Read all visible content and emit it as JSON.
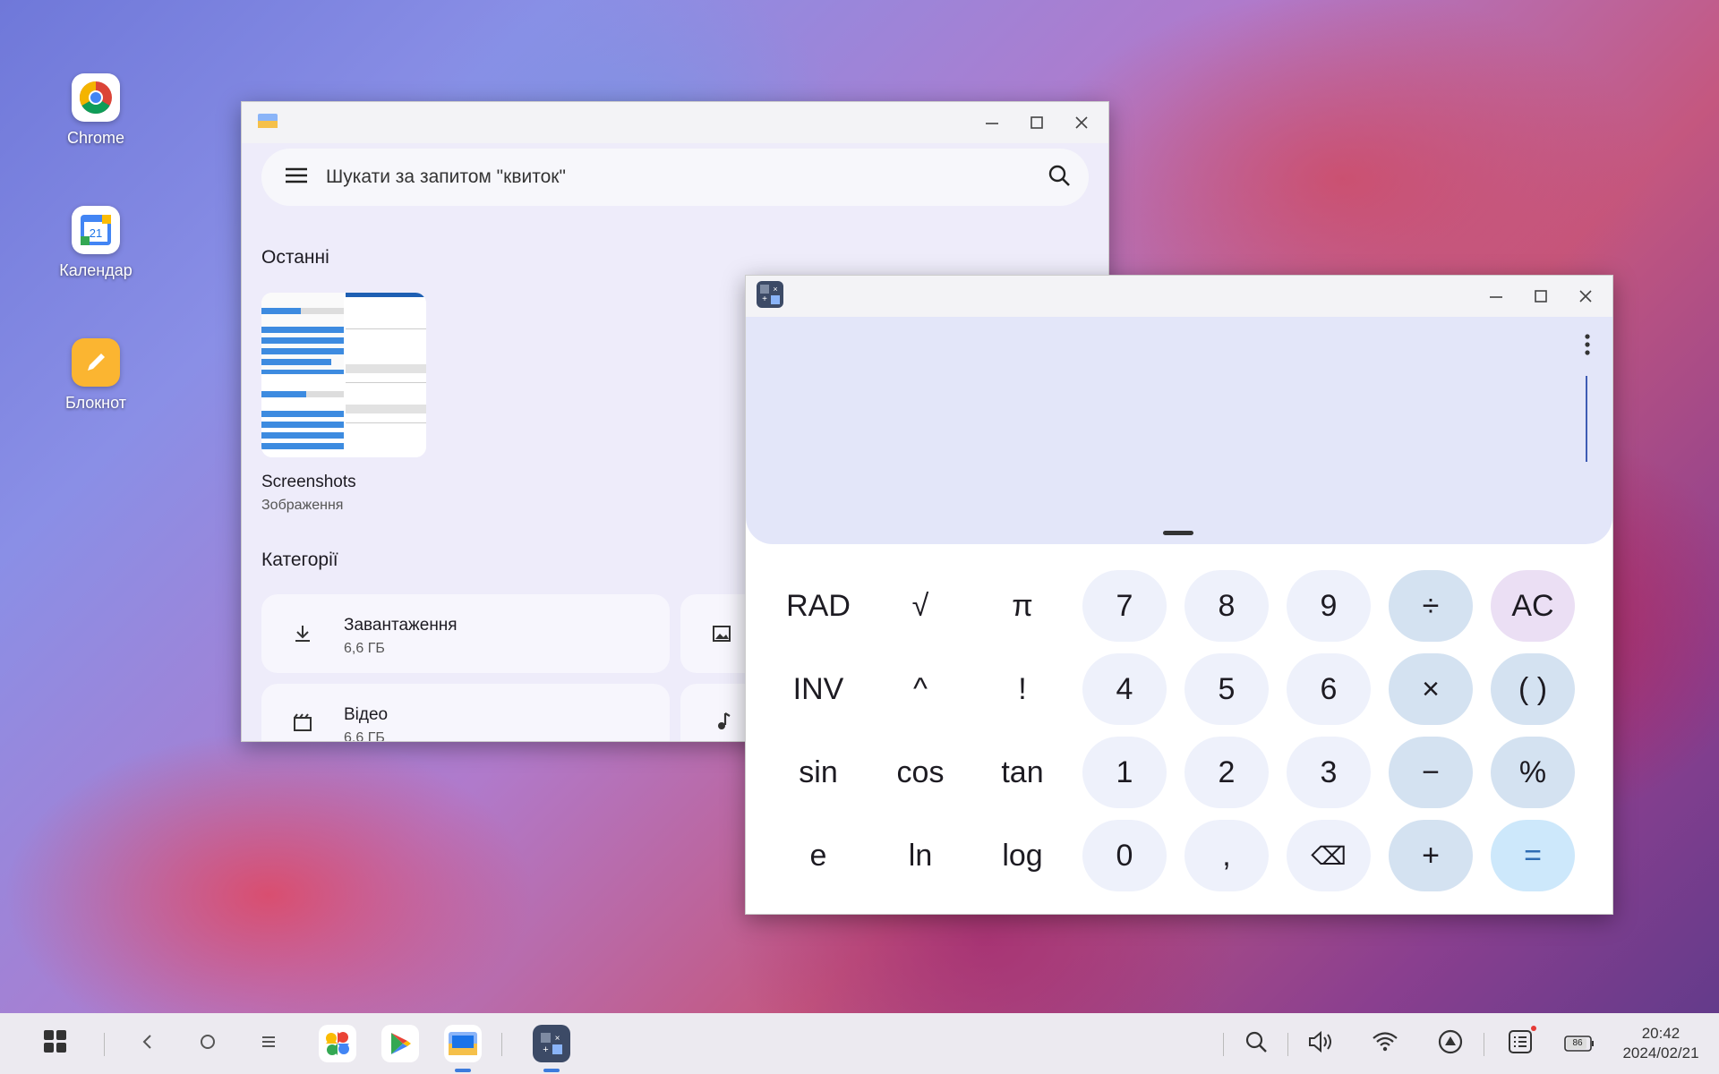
{
  "desktop": {
    "icons": [
      {
        "label": "Chrome"
      },
      {
        "label": "Календар"
      },
      {
        "label": "Блокнот"
      }
    ],
    "calendar_day": "21"
  },
  "files": {
    "search_placeholder": "Шукати за запитом \"квиток\"",
    "recent_title": "Останні",
    "recent_item": {
      "name": "Screenshots",
      "type": "Зображення"
    },
    "categories_title": "Категорії",
    "categories": [
      {
        "name": "Завантаження",
        "size": "6,6 ГБ"
      },
      {
        "name": "Відео",
        "size": "6,6 ГБ"
      }
    ]
  },
  "calculator": {
    "keys": [
      [
        "RAD",
        "√",
        "π",
        "7",
        "8",
        "9",
        "÷",
        "AC"
      ],
      [
        "INV",
        "^",
        "!",
        "4",
        "5",
        "6",
        "×",
        "( )"
      ],
      [
        "sin",
        "cos",
        "tan",
        "1",
        "2",
        "3",
        "−",
        "%"
      ],
      [
        "e",
        "ln",
        "log",
        "0",
        ",",
        "⌫",
        "+",
        "="
      ]
    ]
  },
  "taskbar": {
    "time": "20:42",
    "date": "2024/02/21",
    "battery": "86"
  }
}
